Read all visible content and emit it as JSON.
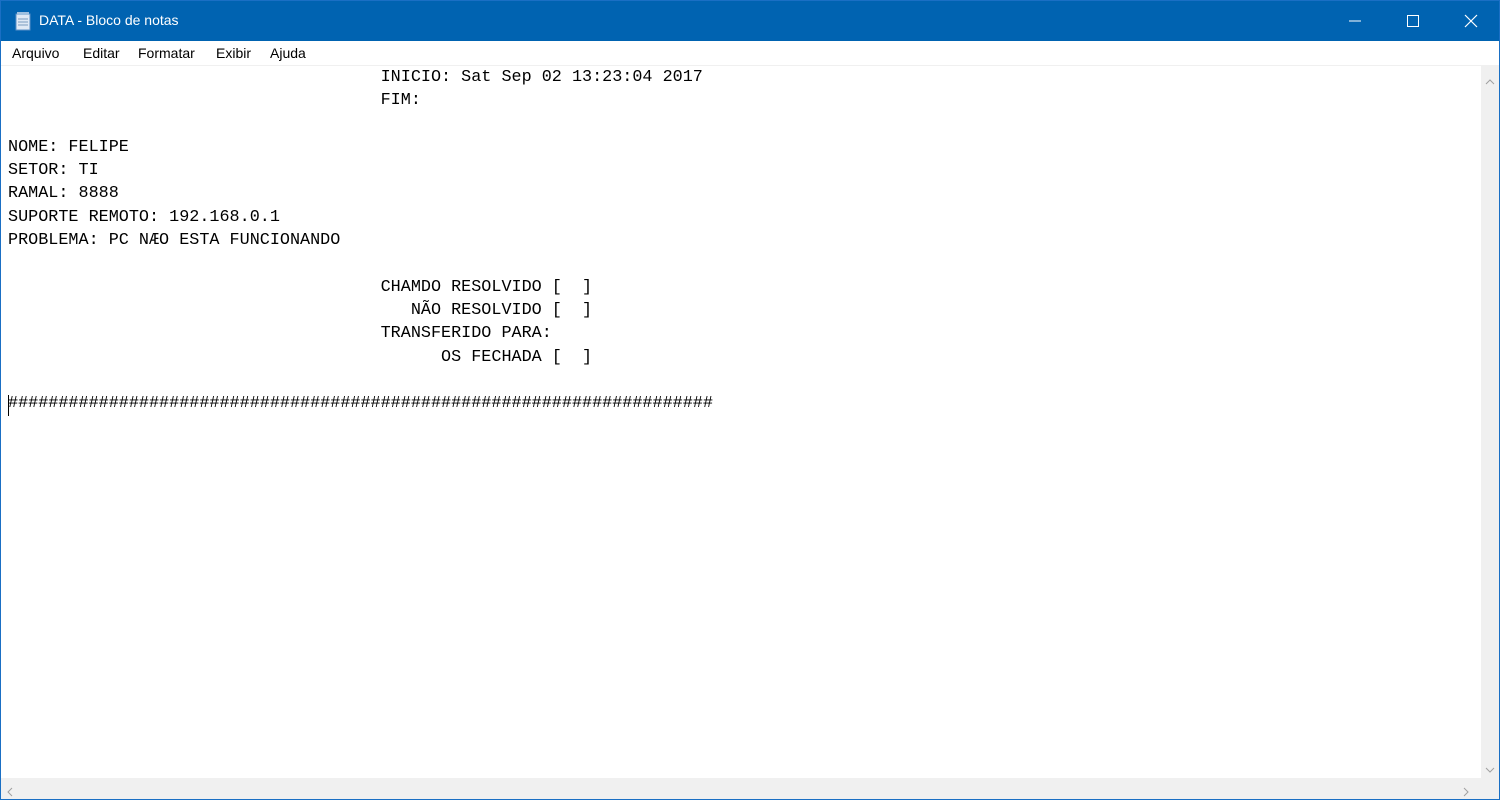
{
  "window": {
    "title": "DATA - Bloco de notas",
    "icons": {
      "app": "notepad-icon",
      "minimize": "minimize-icon",
      "maximize": "maximize-icon",
      "close": "close-icon"
    },
    "colors": {
      "titlebar": "#0063b1",
      "title_text": "#ffffff"
    }
  },
  "menu": {
    "items": [
      {
        "label": "Arquivo"
      },
      {
        "label": "Editar"
      },
      {
        "label": "Formatar"
      },
      {
        "label": "Exibir"
      },
      {
        "label": "Ajuda"
      }
    ]
  },
  "editor": {
    "lines": [
      "                                     INICIO: Sat Sep 02 13:23:04 2017",
      "                                     FIM:",
      "",
      "NOME: FELIPE",
      "SETOR: TI",
      "RAMAL: 8888",
      "SUPORTE REMOTO: 192.168.0.1",
      "PROBLEMA: PC NÆO ESTA FUNCIONANDO",
      "",
      "                                     CHAMDO RESOLVIDO [  ]",
      "                                        NÃO RESOLVIDO [  ]",
      "                                     TRANSFERIDO PARA:",
      "                                           OS FECHADA [  ]",
      "",
      "######################################################################",
      ""
    ]
  },
  "scrollbars": {
    "icons": {
      "up": "scroll-up-arrow-icon",
      "down": "scroll-down-arrow-icon",
      "left": "scroll-left-arrow-icon",
      "right": "scroll-right-arrow-icon"
    }
  }
}
